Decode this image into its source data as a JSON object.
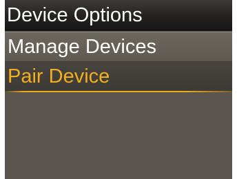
{
  "header": {
    "title": "Device Options"
  },
  "menu": {
    "items": [
      {
        "label": "Manage Devices",
        "selected": false
      },
      {
        "label": "Pair Device",
        "selected": true
      }
    ]
  },
  "colors": {
    "background": "#5a554f",
    "title_bar": "#1c1b1a",
    "selected_text": "#f3ae1c",
    "normal_text": "#ffffff"
  }
}
